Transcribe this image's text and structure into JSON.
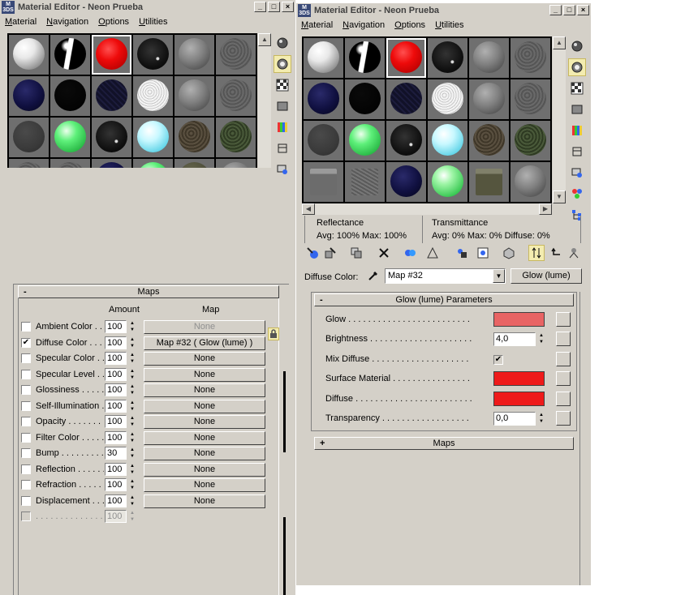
{
  "left_window": {
    "title": "Material Editor - Neon Prueba",
    "menu": [
      "Material",
      "Navigation",
      "Options",
      "Utilities"
    ],
    "maps_rollout": {
      "title": "Maps",
      "toggle": "-",
      "amount_header": "Amount",
      "map_header": "Map",
      "rows": [
        {
          "label": "Ambient Color . . .",
          "checked": false,
          "amount": "100",
          "map": "None",
          "map_disabled": true
        },
        {
          "label": "Diffuse Color . . . .",
          "checked": true,
          "amount": "100",
          "map": "Map #32  ( Glow (lume) )",
          "map_disabled": false
        },
        {
          "label": "Specular Color . .",
          "checked": false,
          "amount": "100",
          "map": "None",
          "map_disabled": false
        },
        {
          "label": "Specular Level  . .",
          "checked": false,
          "amount": "100",
          "map": "None",
          "map_disabled": false
        },
        {
          "label": "Glossiness  . . . . .",
          "checked": false,
          "amount": "100",
          "map": "None",
          "map_disabled": false
        },
        {
          "label": "Self-Illumination . .",
          "checked": false,
          "amount": "100",
          "map": "None",
          "map_disabled": false
        },
        {
          "label": "Opacity  . . . . . . . .",
          "checked": false,
          "amount": "100",
          "map": "None",
          "map_disabled": false
        },
        {
          "label": "Filter Color  . . . . .",
          "checked": false,
          "amount": "100",
          "map": "None",
          "map_disabled": false
        },
        {
          "label": "Bump  . . . . . . . . .",
          "checked": false,
          "amount": "30",
          "map": "None",
          "map_disabled": false
        },
        {
          "label": "Reflection  . . . . . .",
          "checked": false,
          "amount": "100",
          "map": "None",
          "map_disabled": false
        },
        {
          "label": "Refraction  . . . . . .",
          "checked": false,
          "amount": "100",
          "map": "None",
          "map_disabled": false
        },
        {
          "label": "Displacement  . . .",
          "checked": false,
          "amount": "100",
          "map": "None",
          "map_disabled": false
        },
        {
          "label": ". . . . . . . . . . . . . . .",
          "checked": false,
          "amount": "100",
          "map": "",
          "map_disabled": true
        }
      ]
    }
  },
  "right_window": {
    "title": "Material Editor - Neon Prueba",
    "menu": [
      "Material",
      "Navigation",
      "Options",
      "Utilities"
    ],
    "reflectance": {
      "title": "Reflectance",
      "text": "Avg: 100% Max: 100%"
    },
    "transmittance": {
      "title": "Transmittance",
      "text": "Avg:     0% Max:     0%  Diffuse:    0%"
    },
    "diffuse_color": {
      "label": "Diffuse Color:",
      "map_name": "Map #32",
      "map_type": "Glow (lume)"
    },
    "glow_rollout": {
      "title": "Glow (lume) Parameters",
      "toggle": "-",
      "rows": [
        {
          "label": "Glow . . . . . . . . . . . . . . . . . . . . . . . . .",
          "kind": "swatch",
          "color": "#e86464"
        },
        {
          "label": "Brightness . . . . . . . . . . . . . . . . . . . . .",
          "kind": "spinner",
          "value": "4,0"
        },
        {
          "label": "Mix Diffuse . . . . . . . . . . . . . . . . . . . .",
          "kind": "check",
          "checked": true
        },
        {
          "label": "Surface Material . . . . . . . . . . . . . . . .",
          "kind": "swatch",
          "color": "#ee1a1a"
        },
        {
          "label": "Diffuse . . . . . . . . . . . . . . . . . . . . . . . .",
          "kind": "swatch",
          "color": "#ee1a1a"
        },
        {
          "label": "Transparency . . . . . . . . . . . . . . . . . .",
          "kind": "spinner",
          "value": "0,0"
        }
      ]
    },
    "maps_rollout": {
      "title": "Maps",
      "toggle": "+"
    }
  },
  "colors": {
    "ui_gray": "#d4d0c8",
    "active_tool": "#f3ecb0",
    "glow": "#e86464",
    "red": "#ee1a1a"
  },
  "left_slots": [
    {
      "style": "white"
    },
    {
      "style": "black-white-stripe"
    },
    {
      "style": "red",
      "selected": true
    },
    {
      "style": "black-glossy"
    },
    {
      "style": "gray"
    },
    {
      "style": "gray-rough"
    },
    {
      "style": "navy"
    },
    {
      "style": "black"
    },
    {
      "style": "dark-blue-noise"
    },
    {
      "style": "white-bumpy"
    },
    {
      "style": "gray"
    },
    {
      "style": "gray-rough"
    },
    {
      "style": "dark-gray-flat"
    },
    {
      "style": "green"
    },
    {
      "style": "black-glossy"
    },
    {
      "style": "cyan"
    },
    {
      "style": "brown-rough"
    },
    {
      "style": "green-rough"
    },
    {
      "style": "gray-rough"
    },
    {
      "style": "gray-rough"
    },
    {
      "style": "navy"
    },
    {
      "style": "green"
    },
    {
      "style": "olive"
    },
    {
      "style": "gray"
    }
  ],
  "right_slots": [
    {
      "style": "white"
    },
    {
      "style": "black-white-stripe"
    },
    {
      "style": "red",
      "selected": true
    },
    {
      "style": "black-glossy"
    },
    {
      "style": "gray"
    },
    {
      "style": "gray-rough"
    },
    {
      "style": "navy"
    },
    {
      "style": "black"
    },
    {
      "style": "dark-blue-noise"
    },
    {
      "style": "white-bumpy"
    },
    {
      "style": "gray"
    },
    {
      "style": "gray-rough"
    },
    {
      "style": "dark-gray-flat"
    },
    {
      "style": "green"
    },
    {
      "style": "black-glossy"
    },
    {
      "style": "cyan"
    },
    {
      "style": "brown-rough"
    },
    {
      "style": "green-rough"
    },
    {
      "style": "gray-box"
    },
    {
      "style": "gray-box-rough"
    },
    {
      "style": "navy"
    },
    {
      "style": "green-stripe"
    },
    {
      "style": "olive-box"
    },
    {
      "style": "gray"
    }
  ]
}
